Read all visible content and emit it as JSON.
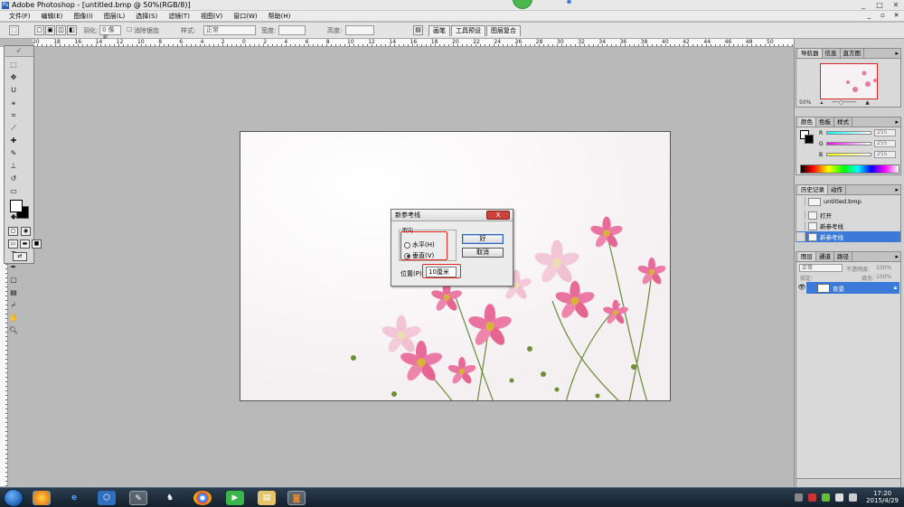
{
  "window": {
    "title": "Adobe Photoshop - [untitled.bmp @ 50%(RGB/8)]",
    "app_logo": "Ps"
  },
  "menu": [
    "文件(F)",
    "编辑(E)",
    "图像(I)",
    "图层(L)",
    "选择(S)",
    "滤镜(T)",
    "视图(V)",
    "窗口(W)",
    "帮助(H)"
  ],
  "options_bar": {
    "feather_label": "羽化:",
    "feather_value": "0 像素",
    "antialias_label": "消除锯齿",
    "style_label": "样式:",
    "style_value": "正常",
    "width_label": "宽度:",
    "height_label": "高度:",
    "palette_tabs": [
      "画笔",
      "工具预设",
      "图层复合"
    ]
  },
  "ruler_top_labels": [
    "20",
    "18",
    "16",
    "14",
    "12",
    "10",
    "8",
    "6",
    "4",
    "2",
    "0",
    "2",
    "4",
    "6",
    "8",
    "10",
    "12",
    "14",
    "16",
    "18",
    "20",
    "22",
    "24",
    "26",
    "28",
    "30",
    "32",
    "34",
    "36",
    "38",
    "40",
    "42",
    "44",
    "46",
    "48",
    "50"
  ],
  "dialog": {
    "title": "新参考线",
    "close_label": "X",
    "orientation_label": "取向",
    "horizontal_label": "水平(H)",
    "vertical_label": "垂直(V)",
    "selected": "vertical",
    "ok_label": "好",
    "cancel_label": "取消",
    "position_label": "位置(P):",
    "position_value": "10厘米"
  },
  "navigator": {
    "tabs": [
      "导航器",
      "信息",
      "直方图"
    ],
    "zoom": "50%"
  },
  "color_panel": {
    "tabs": [
      "颜色",
      "色板",
      "样式"
    ],
    "channels": [
      {
        "name": "R",
        "value": "255",
        "color": "#e24a4a"
      },
      {
        "name": "G",
        "value": "255",
        "color": "#3fbf3f"
      },
      {
        "name": "B",
        "value": "255",
        "color": "#3a5fd8"
      }
    ]
  },
  "history_panel": {
    "tabs": [
      "历史记录",
      "动作"
    ],
    "snapshot": "untitled.bmp",
    "items": [
      "打开",
      "新参考线",
      "新参考线"
    ],
    "active_index": 2
  },
  "layers_panel": {
    "tabs": [
      "图层",
      "通道",
      "路径"
    ],
    "blend_mode": "正常",
    "opacity_label": "不透明度:",
    "opacity": "100%",
    "lock_label": "锁定:",
    "fill_label": "填充:",
    "fill": "100%",
    "layer_name": "背景"
  },
  "taskbar": {
    "time": "17:20",
    "date": "2015/4/29"
  },
  "colors": {
    "accent_selection": "#3b7ad8",
    "annotation_red": "#e2261b"
  }
}
